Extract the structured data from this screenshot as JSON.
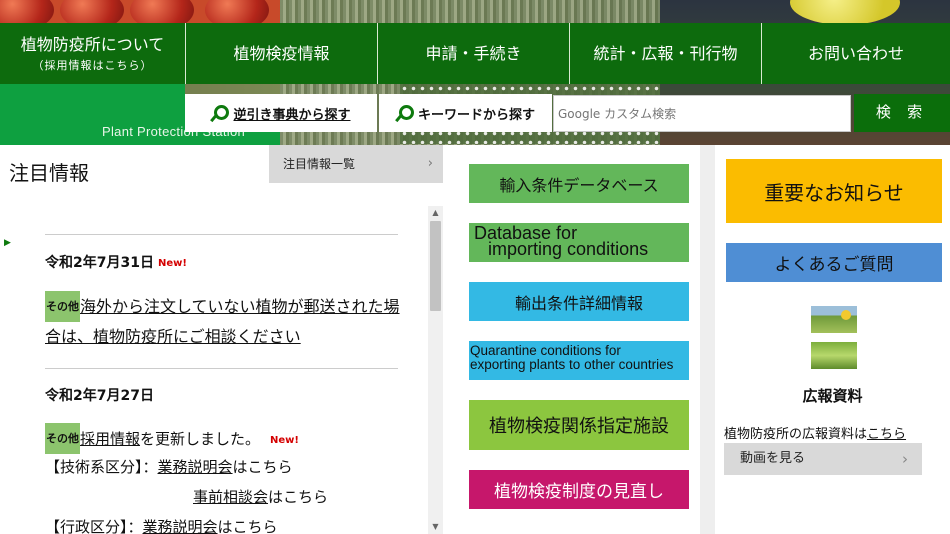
{
  "nav": {
    "items": [
      {
        "label": "植物防疫所について",
        "sub": "（採用情報はこちら）"
      },
      {
        "label": "植物検疫情報"
      },
      {
        "label": "申請・手続き"
      },
      {
        "label": "統計・広報・刊行物"
      },
      {
        "label": "お問い合わせ"
      }
    ]
  },
  "site": {
    "name": "Plant Protection Station"
  },
  "search": {
    "reverse_lookup": "逆引き事典から探す",
    "keyword": "キーワードから探す",
    "placeholder": "Google カスタム検索",
    "button": "検 索"
  },
  "notice": {
    "title": "注目情報",
    "list_button": "注目情報一覧",
    "entries": [
      {
        "date": "令和2年7月31日",
        "new": "New!",
        "tag": "その他",
        "text": "海外から注文していない植物が郵送された場合は、植物防疫所にご相談ください"
      },
      {
        "date": "令和2年7月27日",
        "tag": "その他",
        "link": "採用情報",
        "text": "を更新しました。",
        "new": "New!",
        "lines": [
          {
            "prefix": "【技術系区分】：",
            "link": "業務説明会",
            "suffix": "はこちら"
          },
          {
            "prefix": "",
            "link": "事前相談会",
            "suffix": "はこちら"
          },
          {
            "prefix": "【行政区分】：",
            "link": "業務説明会",
            "suffix": "はこちら"
          }
        ]
      }
    ]
  },
  "middle": {
    "import_db": "輸入条件データベース",
    "import_db_en_1": "Database for",
    "import_db_en_2": "importing conditions",
    "export_info": "輸出条件詳細情報",
    "export_en_1": "Quarantine conditions  for",
    "export_en_2": "exporting plants to other countries",
    "designated": "植物検疫関係指定施設",
    "review": "植物検疫制度の見直し"
  },
  "right": {
    "important": "重要なお知らせ",
    "faq": "よくあるご質問",
    "pr_title": "広報資料",
    "pr_text": "植物防疫所の広報資料は",
    "pr_link": "こちら",
    "video": "動画を見る"
  },
  "colors": {
    "nav_green": "#0d6b0d",
    "band_green": "#0ea040",
    "import_green": "#63b75a",
    "export_blue": "#33b9e4",
    "designated_green": "#8cc63f",
    "review_magenta": "#c6176b",
    "important_yellow": "#fbbc00",
    "faq_blue": "#4f8ed4",
    "new_red": "#d40000"
  }
}
